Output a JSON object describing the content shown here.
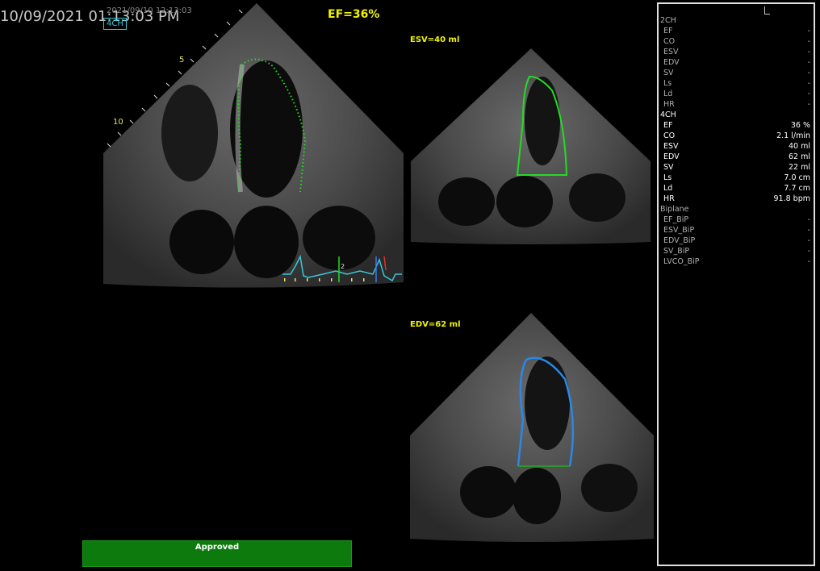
{
  "header": {
    "timestamp": "10/09/2021 01:13:03 PM",
    "acq_timestamp": "2021/09/10 12:13:03",
    "view_label": "4CH",
    "ef_title": "EF=36%",
    "esv_label": "ESV=40 ml",
    "edv_label": "EDV=62 ml"
  },
  "depth_markers": {
    "d5": "5",
    "d10": "10"
  },
  "ecg": {
    "marker": "2"
  },
  "approve_button": {
    "label": "Approved"
  },
  "colors": {
    "accent": "#f2f200",
    "esv_trace": "#22dd22",
    "edv_trace": "#2a88e8",
    "approved_bg": "#0d7a0d",
    "view_box": "#35c8d8"
  },
  "measurements": {
    "sections": [
      {
        "title": "2CH",
        "rows": [
          {
            "label": "EF",
            "value": "-"
          },
          {
            "label": "CO",
            "value": "-"
          },
          {
            "label": "ESV",
            "value": "-"
          },
          {
            "label": "EDV",
            "value": "-"
          },
          {
            "label": "SV",
            "value": "-"
          },
          {
            "label": "Ls",
            "value": "-"
          },
          {
            "label": "Ld",
            "value": "-"
          },
          {
            "label": "HR",
            "value": "-"
          }
        ]
      },
      {
        "title": "4CH",
        "rows": [
          {
            "label": "EF",
            "value": "36 %"
          },
          {
            "label": "CO",
            "value": "2.1 l/min"
          },
          {
            "label": "ESV",
            "value": "40 ml"
          },
          {
            "label": "EDV",
            "value": "62 ml"
          },
          {
            "label": "SV",
            "value": "22 ml"
          },
          {
            "label": "Ls",
            "value": "7.0 cm"
          },
          {
            "label": "Ld",
            "value": "7.7 cm"
          },
          {
            "label": "HR",
            "value": "91.8 bpm"
          }
        ]
      },
      {
        "title": "Biplane",
        "rows": [
          {
            "label": "EF_BiP",
            "value": "-"
          },
          {
            "label": "ESV_BiP",
            "value": "-"
          },
          {
            "label": "EDV_BiP",
            "value": "-"
          },
          {
            "label": "SV_BiP",
            "value": "-"
          },
          {
            "label": "LVCO_BiP",
            "value": "-"
          }
        ]
      }
    ]
  }
}
